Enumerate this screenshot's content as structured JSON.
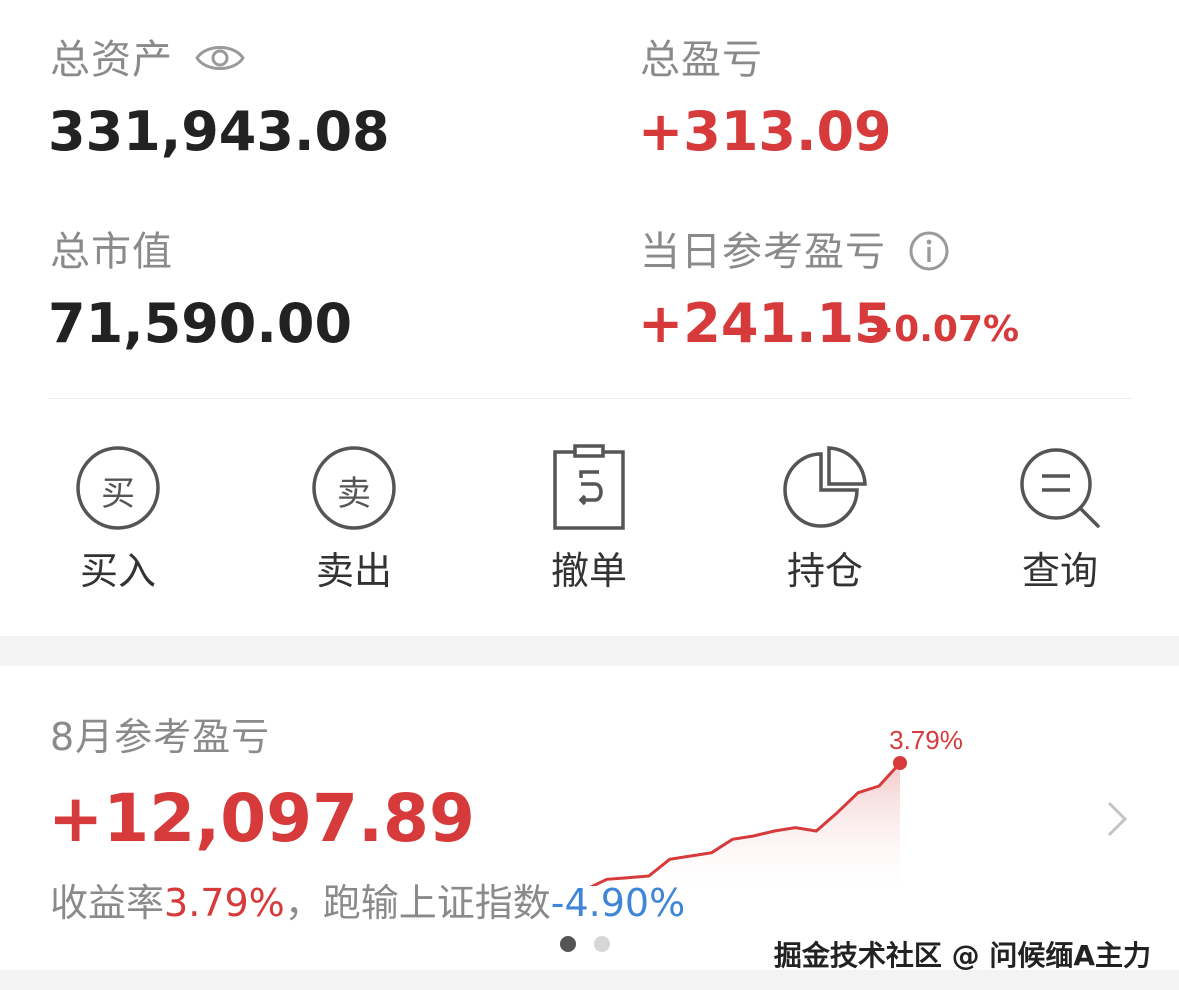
{
  "account": {
    "total_assets_label": "总资产",
    "total_assets_value": "331,943.08",
    "total_pnl_label": "总盈亏",
    "total_pnl_value": "+313.09",
    "market_value_label": "总市值",
    "market_value_value": "71,590.00",
    "daily_pnl_label": "当日参考盈亏",
    "daily_pnl_value": "+241.15",
    "daily_pnl_percent": "+0.07%"
  },
  "actions": [
    {
      "label": "买入",
      "icon_char": "买",
      "icon": "buy-icon"
    },
    {
      "label": "卖出",
      "icon_char": "卖",
      "icon": "sell-icon"
    },
    {
      "label": "撤单",
      "icon": "cancel-order-icon"
    },
    {
      "label": "持仓",
      "icon": "pie-chart-icon"
    },
    {
      "label": "查询",
      "icon": "search-icon"
    }
  ],
  "monthly": {
    "title": "8月参考盈亏",
    "value": "+12,097.89",
    "yield_label": "收益率",
    "yield_value": "3.79%",
    "compare_label": "，跑输上证指数",
    "compare_value": "-4.90%"
  },
  "chart_data": {
    "type": "area",
    "end_label": "3.79%",
    "baseline": 0,
    "values": [
      0.0,
      0.3,
      0.35,
      0.4,
      0.9,
      1.0,
      1.1,
      1.5,
      1.6,
      1.75,
      1.85,
      1.75,
      2.3,
      2.9,
      3.1,
      3.79
    ],
    "ylim": [
      -0.5,
      4.0
    ],
    "colors": {
      "line": "#d63a3a",
      "fill": "#f6d8d8",
      "baseline": "#cfcfcf"
    }
  },
  "pagination": {
    "total": 2,
    "active": 0
  },
  "watermark": "掘金技术社区 @ 问候缅A主力",
  "colors": {
    "red": "#d63a3a",
    "blue": "#3f86d6",
    "gray_text": "#8a8a8a",
    "dark_text": "#222222"
  }
}
